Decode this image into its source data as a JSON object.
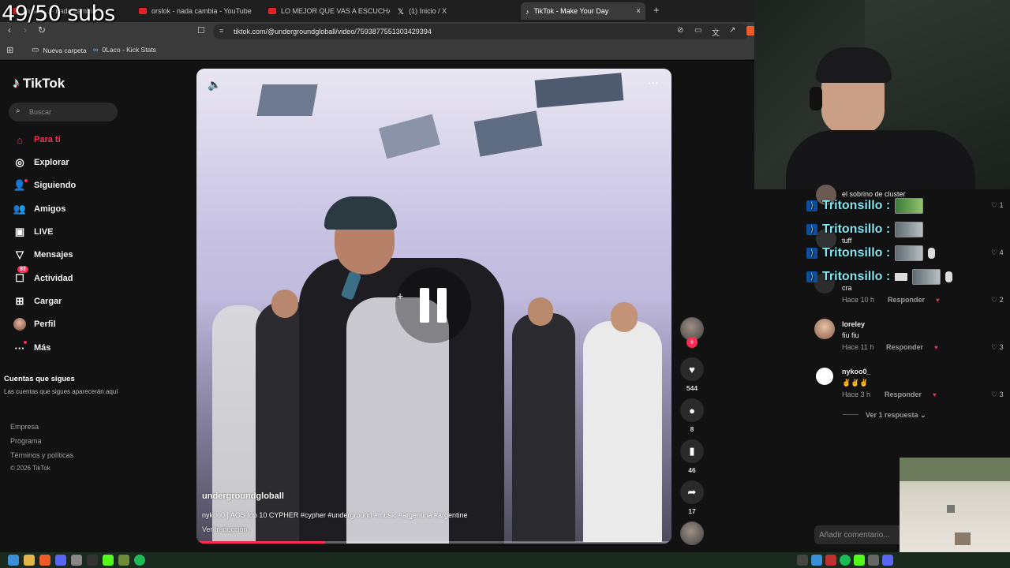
{
  "overlay": {
    "subs_counter": "49/50 subs"
  },
  "browser": {
    "tabs": [
      {
        "label": "Busca... - nada cambia",
        "color": "#e32323"
      },
      {
        "label": "orslok - nada cambia - YouTube",
        "color": "#e32323"
      },
      {
        "label": "LO MEJOR QUE VAS A ESCUCHAR HOY",
        "color": "#e32323"
      },
      {
        "label": "(1) Inicio / X",
        "color": "#ffffff"
      },
      {
        "label": "TikTok - Make Your Day",
        "color": "#ffffff"
      }
    ],
    "new_tab": "+",
    "close_tab": "×",
    "url": "tiktok.com/@undergroundgloball/video/7593877551303429394",
    "bookmarks": [
      {
        "label": "Nueva carpeta"
      },
      {
        "label": "0Laco - Kick Stats"
      }
    ]
  },
  "sidebar": {
    "logo": "TikTok",
    "search_placeholder": "Buscar",
    "items": [
      {
        "label": "Para ti",
        "icon": "home-icon"
      },
      {
        "label": "Explorar",
        "icon": "compass-icon"
      },
      {
        "label": "Siguiendo",
        "icon": "user-follow-icon"
      },
      {
        "label": "Amigos",
        "icon": "friends-icon"
      },
      {
        "label": "LIVE",
        "icon": "live-icon"
      },
      {
        "label": "Mensajes",
        "icon": "message-icon"
      },
      {
        "label": "Actividad",
        "icon": "activity-icon",
        "badge": "93"
      },
      {
        "label": "Cargar",
        "icon": "upload-icon"
      },
      {
        "label": "Perfil",
        "icon": "avatar"
      },
      {
        "label": "Más",
        "icon": "more-icon"
      }
    ],
    "following_title": "Cuentas que sigues",
    "following_desc": "Las cuentas que sigues aparecerán aquí",
    "footer": {
      "company": "Empresa",
      "program": "Programa",
      "terms": "Términos y políticas",
      "copyright": "© 2026 TikTok"
    }
  },
  "video": {
    "username": "undergroundgloball",
    "caption": "nykoo0 | AOS top 10 CYPHER #cypher #underground #music #argentina #argentine",
    "translate": "Ver traducción",
    "progress": 0.27
  },
  "actions": {
    "likes": "544",
    "comments": "8",
    "saves": "46",
    "shares": "17"
  },
  "comments": {
    "items": [
      {
        "user": "el sobrino de cluster",
        "text": "",
        "time": "",
        "reply": "",
        "likes": "1"
      },
      {
        "user": "",
        "text": "tuff",
        "time": "",
        "reply": "",
        "likes": "4"
      },
      {
        "user": "",
        "text": "cra",
        "time": "Hace 10 h",
        "reply": "Responder",
        "likes": "2"
      },
      {
        "user": "loreley",
        "text": "fiu fiu",
        "time": "Hace 11 h",
        "reply": "Responder",
        "likes": "3"
      },
      {
        "user": "nykoo0_",
        "text": "✌️✌️✌️",
        "time": "Hace 3 h",
        "reply": "Responder",
        "likes": "3"
      }
    ],
    "view_replies": "Ver 1 respuesta",
    "add_comment_placeholder": "Añadir comentario..."
  },
  "chat_overlay": {
    "messages": [
      {
        "user": "Tritonsillo :"
      },
      {
        "user": "Tritonsillo :"
      },
      {
        "user": "Tritonsillo :"
      },
      {
        "user": "Tritonsillo :"
      }
    ]
  },
  "colors": {
    "accent": "#fe2c55",
    "chat": "#7fe9f5"
  }
}
